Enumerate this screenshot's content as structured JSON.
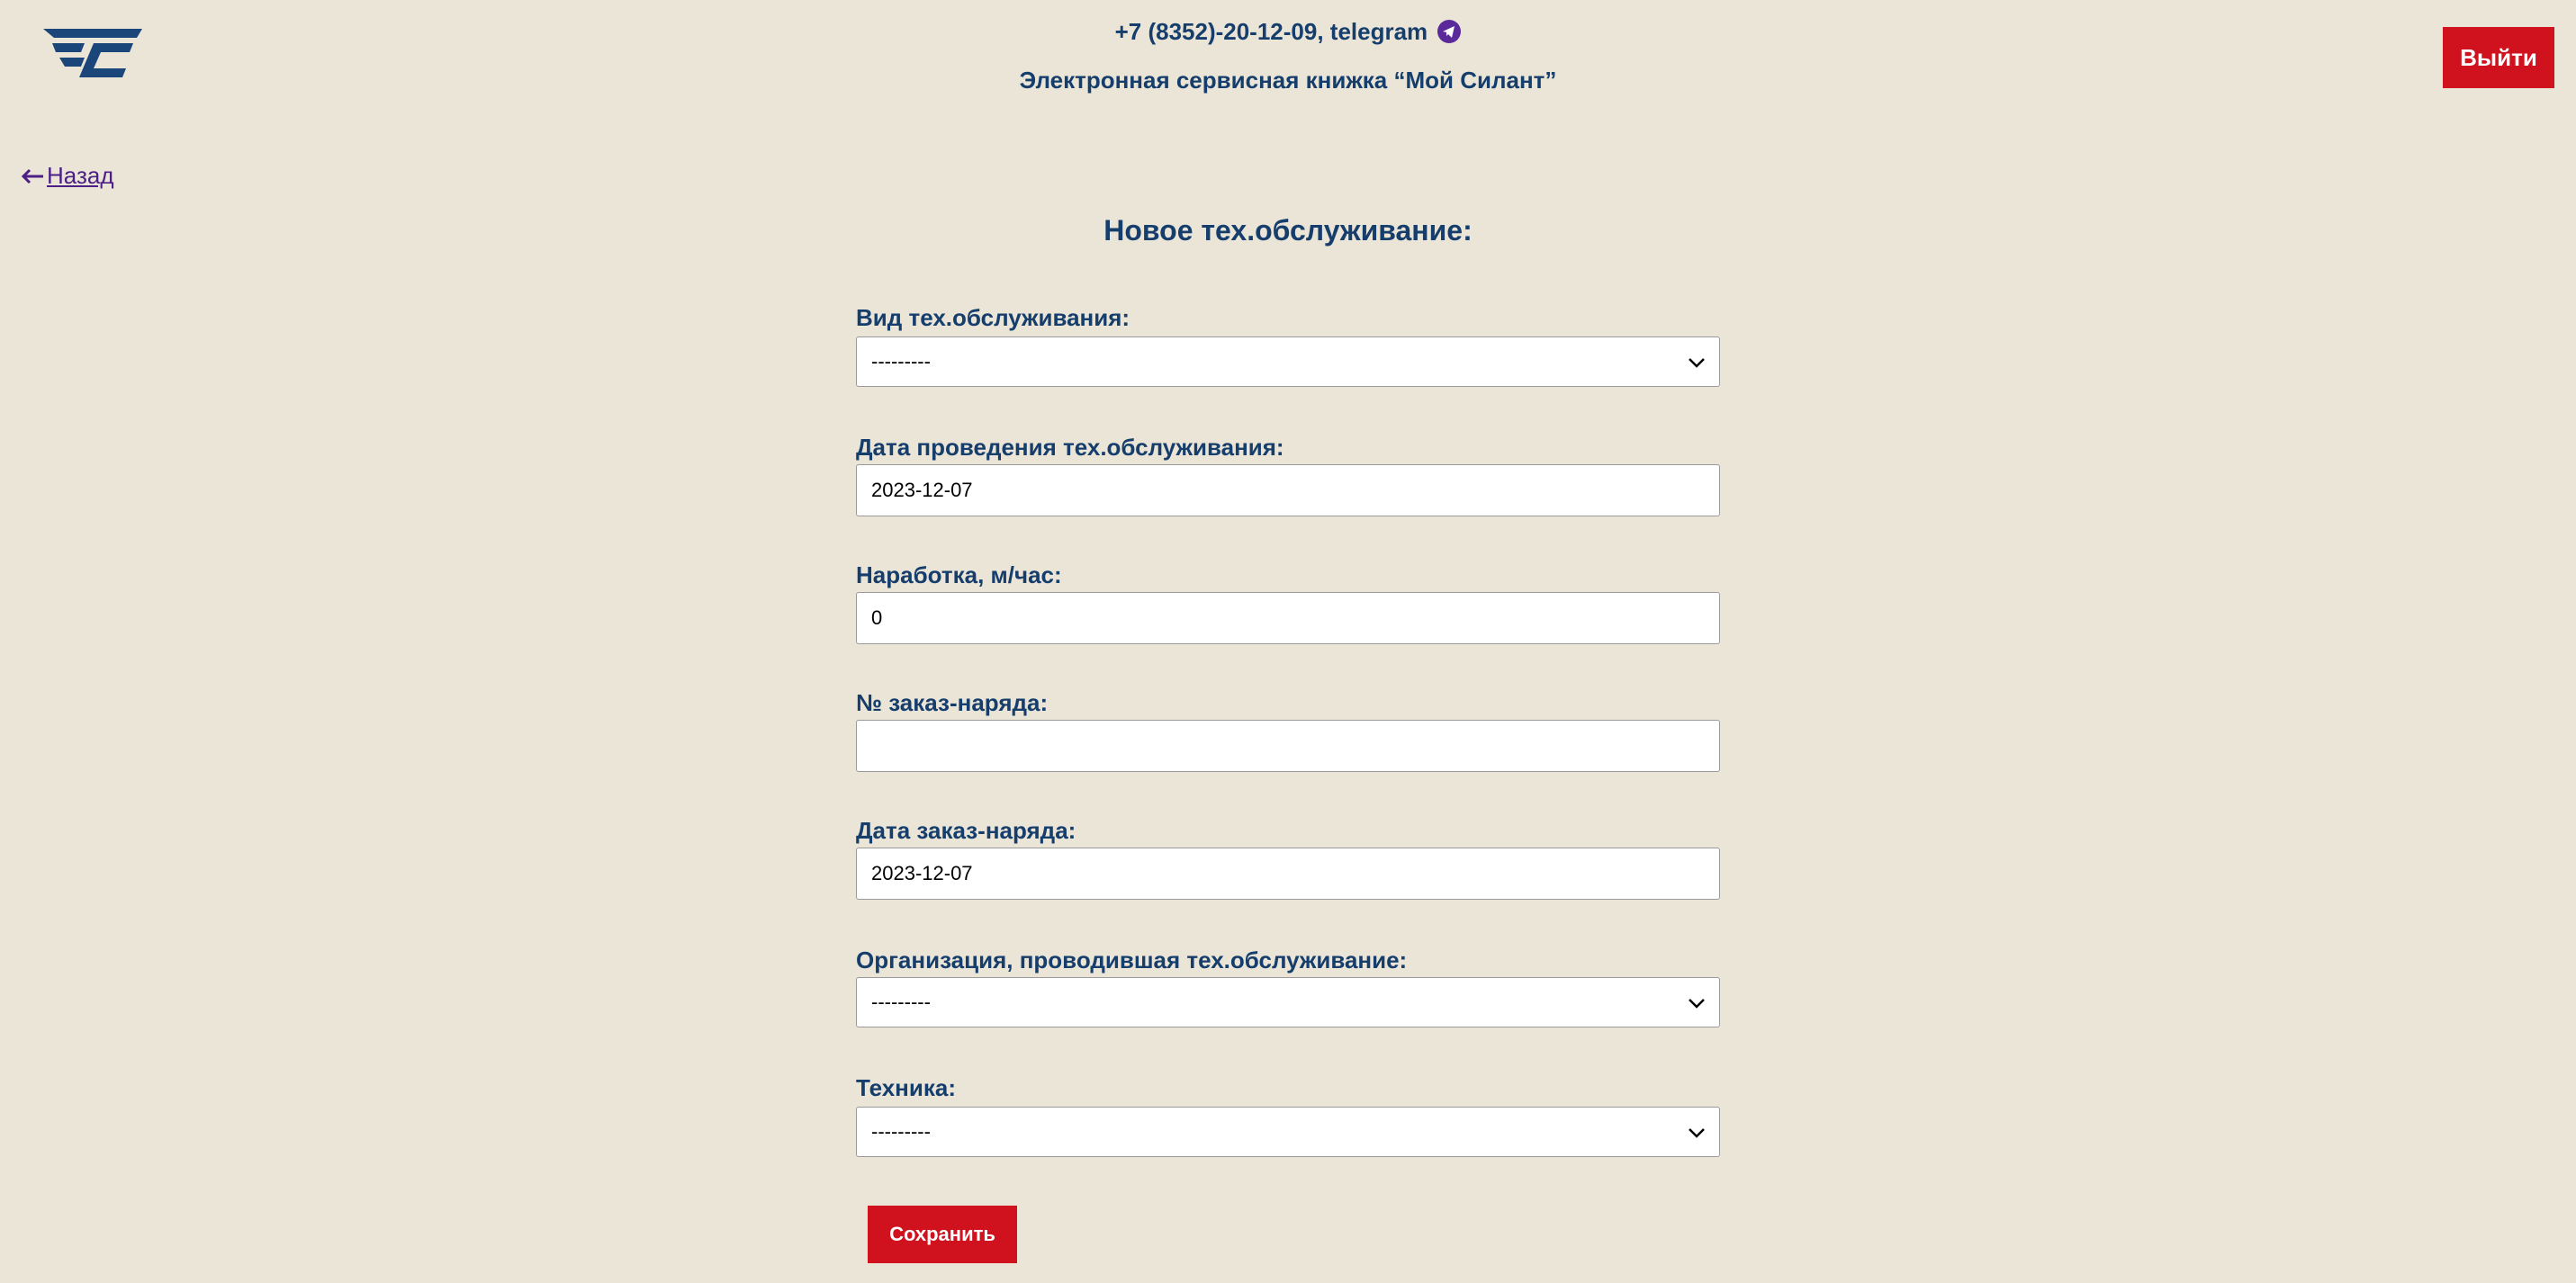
{
  "header": {
    "phone": "+7 (8352)-20-12-09, telegram",
    "title": "Электронная сервисная книжка “Мой Силант”",
    "logout_label": "Выйти"
  },
  "nav": {
    "back_label": "Назад"
  },
  "form": {
    "title": "Новое тех.обслуживание:",
    "fields": [
      {
        "label": "Вид тех.обслуживания:",
        "type": "select",
        "value": "---------"
      },
      {
        "label": "Дата проведения тех.обслуживания:",
        "type": "input",
        "value": "2023-12-07"
      },
      {
        "label": "Наработка, м/час:",
        "type": "input",
        "value": "0"
      },
      {
        "label": "№ заказ-наряда:",
        "type": "input",
        "value": ""
      },
      {
        "label": "Дата заказ-наряда:",
        "type": "input",
        "value": "2023-12-07"
      },
      {
        "label": "Организация, проводившая тех.обслуживание:",
        "type": "select",
        "value": "---------"
      },
      {
        "label": "Техника:",
        "type": "select",
        "value": "---------"
      }
    ],
    "save_label": "Сохранить"
  },
  "colors": {
    "background": "#ebe5d8",
    "primary_text": "#163e6c",
    "accent_red": "#d0121e",
    "link_purple": "#4b1f86"
  },
  "icons": {
    "logo": "silant-logo-icon",
    "telegram": "telegram-icon",
    "back": "arrow-left-icon",
    "dropdown": "chevron-down-icon"
  }
}
